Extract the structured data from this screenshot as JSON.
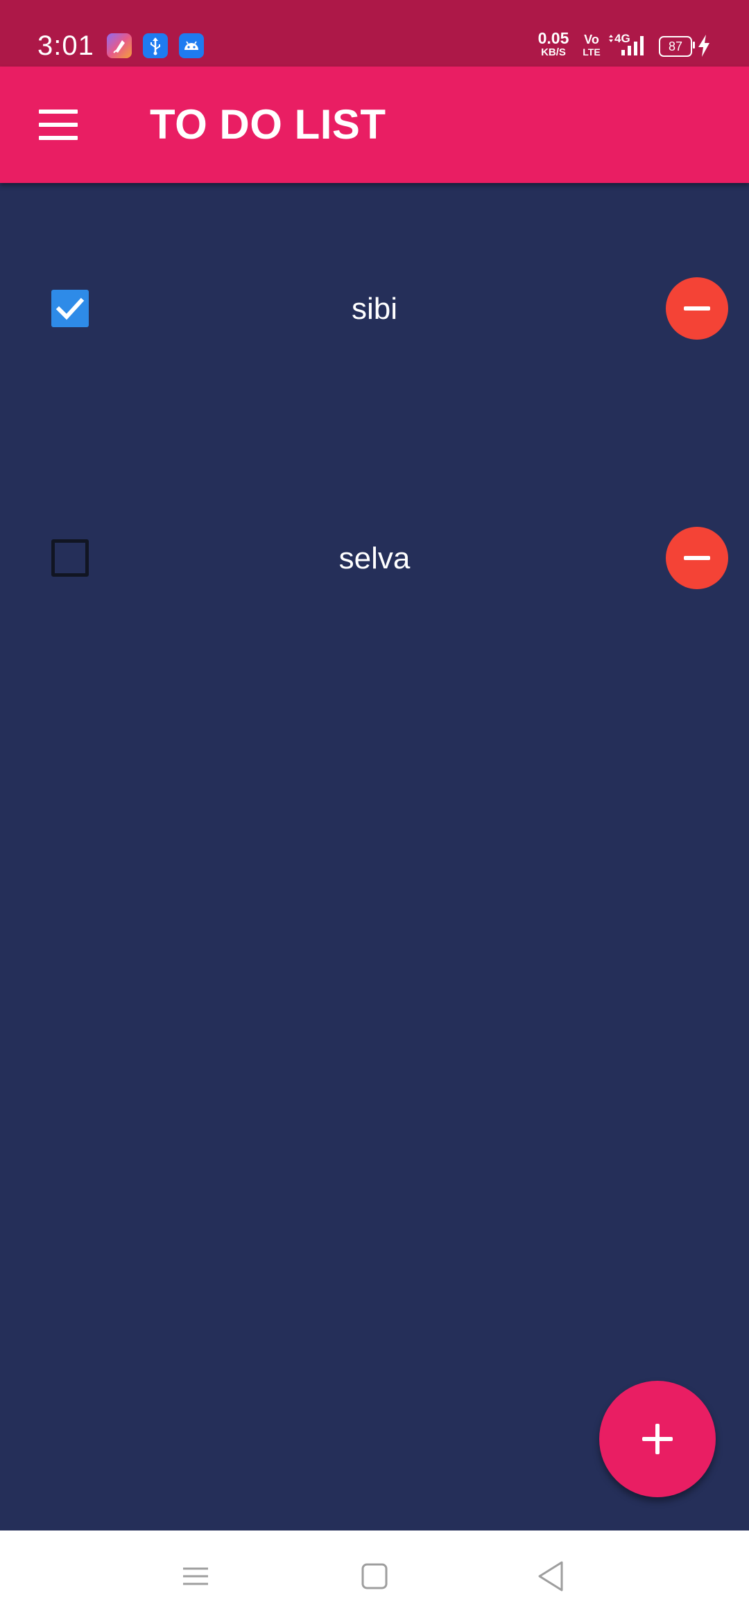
{
  "status_bar": {
    "time": "3:01",
    "net_speed_value": "0.05",
    "net_speed_unit": "KB/S",
    "volte_top": "Vo",
    "volte_bottom": "LTE",
    "network_type": "4G",
    "battery_level": "87",
    "notification_icons": [
      "feather-app-icon",
      "usb-icon",
      "android-debug-icon"
    ]
  },
  "app_bar": {
    "title": "TO DO LIST",
    "menu_icon": "hamburger-menu-icon"
  },
  "todos": [
    {
      "label": "sibi",
      "checked": true
    },
    {
      "label": "selva",
      "checked": false
    }
  ],
  "fab": {
    "icon": "plus-icon"
  },
  "nav_bar": {
    "buttons": [
      "recents-icon",
      "home-icon",
      "back-icon"
    ]
  },
  "colors": {
    "status_bar": "#AD1848",
    "app_bar": "#E91E63",
    "background": "#252F59",
    "checkbox_checked": "#2E8BE8",
    "remove_button": "#F44336",
    "fab": "#E91E63"
  }
}
